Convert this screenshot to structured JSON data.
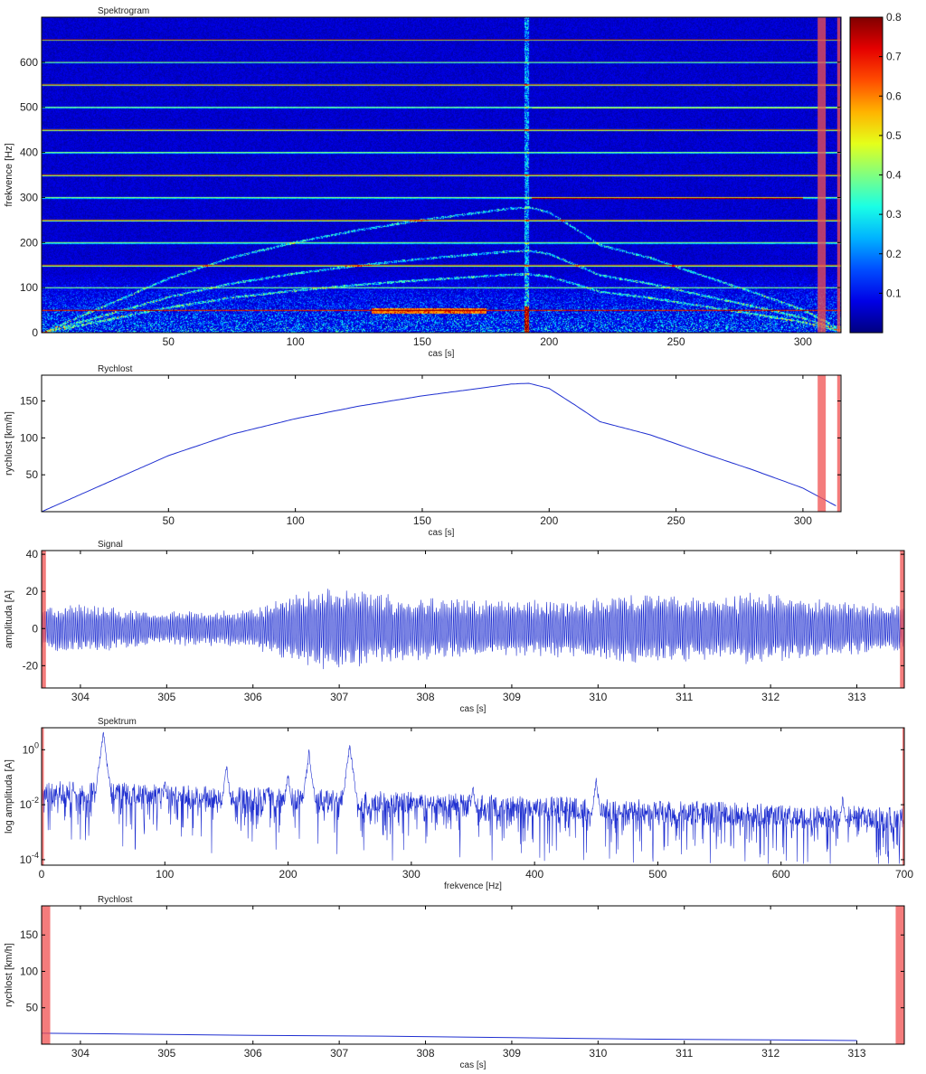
{
  "chart_data": [
    {
      "id": "spektrogram",
      "type": "heatmap",
      "title": "Spektrogram",
      "xlabel": "cas [s]",
      "ylabel": "frekvence [Hz]",
      "xlim": [
        0,
        315
      ],
      "ylim": [
        0,
        700
      ],
      "xticks": [
        50,
        100,
        150,
        200,
        250,
        300
      ],
      "yticks": [
        0,
        100,
        200,
        300,
        400,
        500,
        600
      ],
      "colormap": "jet",
      "colorbar": {
        "range": [
          0,
          0.8
        ],
        "ticks": [
          0.1,
          0.2,
          0.3,
          0.4,
          0.5,
          0.6,
          0.7,
          0.8
        ]
      },
      "harmonic_lines_hz": [
        50,
        100,
        150,
        200,
        250,
        300,
        350,
        400,
        450,
        500,
        550,
        600,
        650
      ],
      "highlight_cas_s": [
        [
          305.8,
          309.0
        ],
        [
          313.5,
          314.7
        ]
      ]
    },
    {
      "id": "rychlost-1",
      "type": "line",
      "title": "Rychlost",
      "xlabel": "cas [s]",
      "ylabel": "rychlost [km/h]",
      "xlim": [
        0,
        315
      ],
      "ylim": [
        0,
        185
      ],
      "xticks": [
        50,
        100,
        150,
        200,
        250,
        300
      ],
      "yticks": [
        50,
        100,
        150
      ],
      "series": [
        {
          "x": [
            0,
            25,
            50,
            75,
            100,
            125,
            150,
            170,
            185,
            192,
            200,
            210,
            220,
            240,
            260,
            280,
            300,
            313
          ],
          "y": [
            0,
            38,
            76,
            105,
            126,
            143,
            157,
            166,
            173,
            174,
            167,
            145,
            122,
            104,
            80,
            57,
            32,
            8
          ]
        }
      ],
      "highlight_cas_s": [
        [
          305.8,
          309.0
        ],
        [
          313.5,
          314.7
        ]
      ]
    },
    {
      "id": "signal",
      "type": "line",
      "title": "Signal",
      "xlabel": "cas [s]",
      "ylabel": "amplituda [A]",
      "xlim": [
        303.55,
        313.55
      ],
      "ylim": [
        -32,
        42
      ],
      "xticks": [
        304,
        305,
        306,
        307,
        308,
        309,
        310,
        311,
        312,
        313
      ],
      "yticks": [
        -20,
        0,
        20,
        40
      ],
      "envelope": {
        "x": [
          303.55,
          304.2,
          304.5,
          305.0,
          305.5,
          306.0,
          306.3,
          306.6,
          307.0,
          307.3,
          308.0,
          309.0,
          309.8,
          310.3,
          310.6,
          311.0,
          311.5,
          311.7,
          312.2,
          312.8,
          313.5
        ],
        "amp": [
          12,
          13,
          10,
          9,
          9,
          10,
          16,
          20,
          22,
          19,
          16,
          15,
          15,
          18,
          19,
          17,
          16,
          19,
          17,
          14,
          13
        ]
      },
      "highlight_cas_s": [
        [
          303.55,
          303.6
        ],
        [
          313.5,
          313.55
        ]
      ]
    },
    {
      "id": "spektrum",
      "type": "line",
      "title": "Spektrum",
      "xlabel": "frekvence [Hz]",
      "ylabel": "log amplituda [A]",
      "xlim": [
        0,
        700
      ],
      "ylim_log10": [
        -4.2,
        0.8
      ],
      "yscale": "log",
      "xticks": [
        0,
        100,
        200,
        300,
        400,
        500,
        600,
        700
      ],
      "yticks_exp": [
        -4,
        -2,
        0
      ],
      "peaks_hz": [
        {
          "f": 50,
          "log": 0.6
        },
        {
          "f": 150,
          "log": -0.6
        },
        {
          "f": 200,
          "log": -0.9
        },
        {
          "f": 217,
          "log": -0.1
        },
        {
          "f": 250,
          "log": 0.2
        },
        {
          "f": 100,
          "log": -1.2
        },
        {
          "f": 350,
          "log": -1.4
        },
        {
          "f": 450,
          "log": -1.1
        },
        {
          "f": 650,
          "log": -1.8
        }
      ],
      "highlight_hz": [
        [
          0,
          1.5
        ],
        [
          698.5,
          700
        ]
      ]
    },
    {
      "id": "rychlost-2",
      "type": "line",
      "title": "Rychlost",
      "xlabel": "cas [s]",
      "ylabel": "rychlost [km/h]",
      "xlim": [
        303.55,
        313.55
      ],
      "ylim": [
        0,
        190
      ],
      "xticks": [
        304,
        305,
        306,
        307,
        308,
        309,
        310,
        311,
        312,
        313
      ],
      "yticks": [
        50,
        100,
        150
      ],
      "series": [
        {
          "x": [
            303.55,
            304.5,
            306,
            307.5,
            309,
            310.5,
            312,
            313
          ],
          "y": [
            15,
            14,
            12,
            11,
            9,
            7,
            6,
            5
          ]
        }
      ],
      "highlight_cas_s": [
        [
          303.55,
          303.65
        ],
        [
          313.45,
          313.55
        ]
      ]
    }
  ]
}
